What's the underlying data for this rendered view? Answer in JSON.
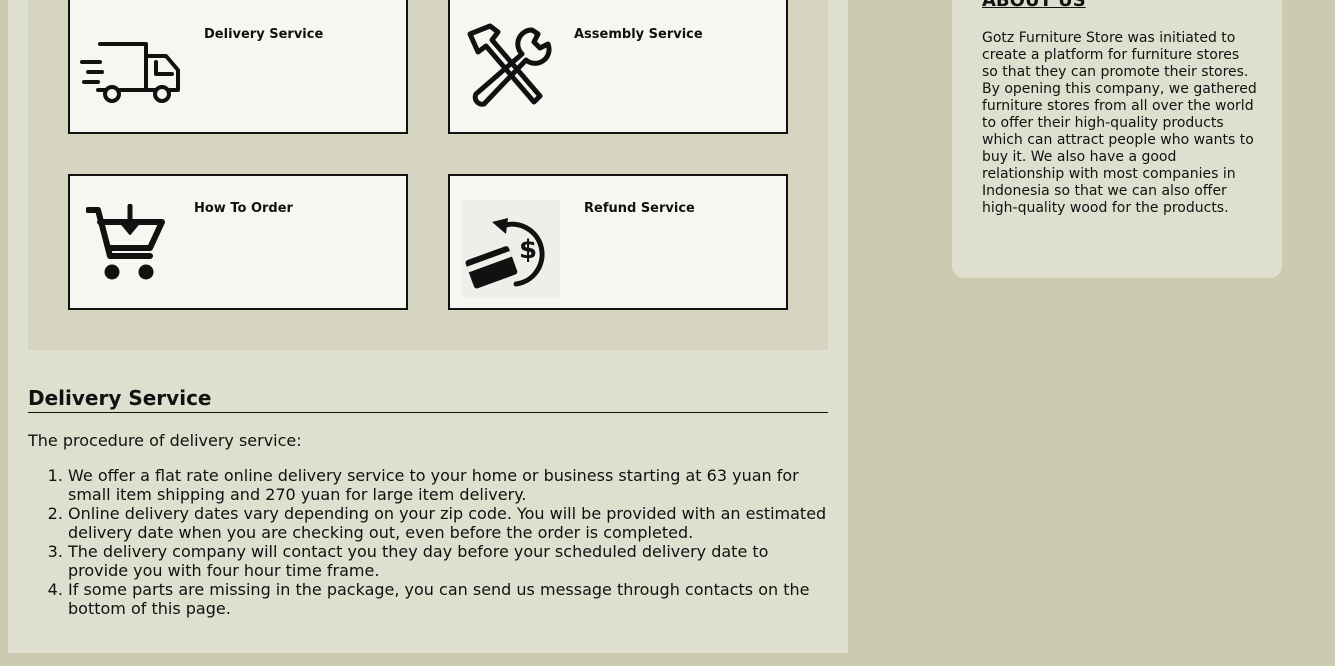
{
  "services": {
    "delivery": {
      "title": "Delivery Service",
      "icon": "delivery-truck-icon"
    },
    "assembly": {
      "title": "Assembly Service",
      "icon": "hammer-wrench-icon"
    },
    "order": {
      "title": "How To Order",
      "icon": "shopping-cart-icon"
    },
    "refund": {
      "title": "Refund Service",
      "icon": "refund-card-icon"
    }
  },
  "delivery_section": {
    "heading": "Delivery Service",
    "intro": "The procedure of delivery service:",
    "steps": [
      "We offer a flat rate online delivery service to your home or business starting at 63 yuan for small item shipping and 270 yuan for large item delivery.",
      "Online delivery dates vary depending on your zip code. You will be provided with an estimated delivery date when you are checking out, even before the order is completed.",
      "The delivery company will contact you they day before your scheduled delivery date to provide you with four hour time frame.",
      "If some parts are missing in the package, you can send us message through contacts on the bottom of this page."
    ]
  },
  "about": {
    "heading": "ABOUT US",
    "text": "Gotz Furniture Store was initiated to create a platform for furniture stores so that they can promote their stores. By opening this company, we gathered furniture stores from all over the world to offer their high-quality products which can attract people who wants to buy it. We also have a good relationship with most companies in Indonesia so that we can also offer high-quality wood for the products."
  },
  "colors": {
    "page_bg": "#cccbb1",
    "panel_bg": "#dfdfd0",
    "grid_bg": "#d5d5c1",
    "card_bg": "#f7f7f2"
  }
}
